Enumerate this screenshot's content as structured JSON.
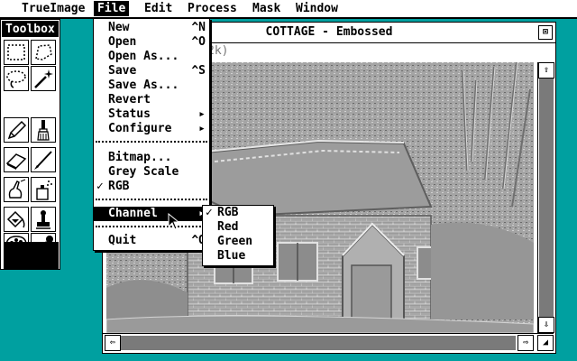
{
  "menubar": {
    "items": [
      {
        "label": "TrueImage",
        "active": false
      },
      {
        "label": "File",
        "active": true
      },
      {
        "label": "Edit",
        "active": false
      },
      {
        "label": "Process",
        "active": false
      },
      {
        "label": "Mask",
        "active": false
      },
      {
        "label": "Window",
        "active": false
      }
    ]
  },
  "toolbox": {
    "title": "Toolbox",
    "tools": [
      "rectangle-select-icon",
      "lasso-select-icon",
      "freehand-select-icon",
      "magic-wand-icon",
      "pencil-icon",
      "brush-icon",
      "eraser-icon",
      "fine-brush-icon",
      "smudge-icon",
      "airbrush-icon",
      "fill-bucket-icon",
      "stamp-icon",
      "palette-icon",
      "eyedropper-icon"
    ],
    "current_color": "#000000"
  },
  "document": {
    "title": "COTTAGE - Embossed",
    "close_glyph": "⊠",
    "info_fragment": "2k)"
  },
  "file_menu": {
    "items": [
      {
        "label": "New",
        "shortcut": "^N"
      },
      {
        "label": "Open",
        "shortcut": "^O"
      },
      {
        "label": "Open As...",
        "shortcut": ""
      },
      {
        "label": "Save",
        "shortcut": "^S"
      },
      {
        "label": "Save As...",
        "shortcut": ""
      },
      {
        "label": "Revert",
        "shortcut": ""
      },
      {
        "label": "Status",
        "shortcut": "▸"
      },
      {
        "label": "Configure",
        "shortcut": "▸"
      },
      {
        "label": "Bitmap...",
        "shortcut": ""
      },
      {
        "label": "Grey Scale",
        "shortcut": ""
      },
      {
        "label": "RGB",
        "shortcut": "",
        "checked": true
      },
      {
        "label": "Channel",
        "shortcut": "▸",
        "highlighted": true
      },
      {
        "label": "Quit",
        "shortcut": "^Q"
      }
    ]
  },
  "channel_submenu": {
    "items": [
      {
        "label": "RGB",
        "checked": true
      },
      {
        "label": "Red",
        "checked": false
      },
      {
        "label": "Green",
        "checked": false
      },
      {
        "label": "Blue",
        "checked": false
      }
    ]
  },
  "glyphs": {
    "check": "✓",
    "arrow_up": "⇧",
    "arrow_down": "⇩",
    "arrow_left": "⇦",
    "arrow_right": "⇨",
    "resize": "◢"
  },
  "colors": {
    "desktop": "#00a0a0",
    "image_mid": "#a4a4a4"
  }
}
